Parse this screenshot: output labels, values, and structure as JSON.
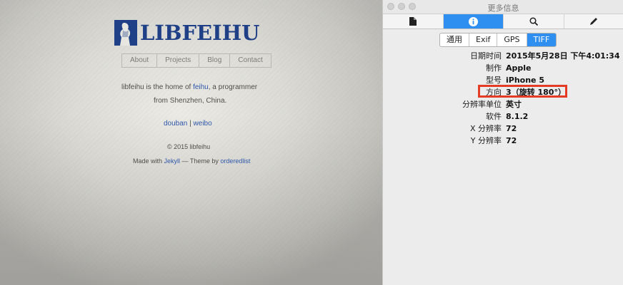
{
  "site": {
    "logo_text": "LIBFEIHU",
    "nav": [
      "About",
      "Projects",
      "Blog",
      "Contact"
    ],
    "intro_before": "libfeihu is the home of ",
    "intro_link": "feihu",
    "intro_after": ", a programmer",
    "intro_line2": "from Shenzhen, China.",
    "social": [
      "douban",
      "weibo"
    ],
    "social_sep": "|",
    "copyright": "© 2015 libfeihu",
    "made_with": "Made with ",
    "jekyll": "Jekyll",
    "theme_by": " — Theme by ",
    "theme_author": "orderedlist"
  },
  "panel": {
    "window_title": "更多信息",
    "toolbar_icons": [
      "file-icon",
      "info-icon",
      "search-icon",
      "pencil-icon"
    ],
    "active_toolbar_index": 1,
    "segments": [
      "通用",
      "Exif",
      "GPS",
      "TIFF"
    ],
    "active_segment": "TIFF",
    "rows": [
      {
        "label": "日期时间",
        "value": "2015年5月28日 下午4:01:34"
      },
      {
        "label": "制作",
        "value": "Apple"
      },
      {
        "label": "型号",
        "value": "iPhone 5"
      },
      {
        "label": "方向",
        "value": "3（旋转 180°）"
      },
      {
        "label": "分辨率单位",
        "value": "英寸"
      },
      {
        "label": "软件",
        "value": "8.1.2"
      },
      {
        "label": "X 分辨率",
        "value": "72"
      },
      {
        "label": "Y 分辨率",
        "value": "72"
      }
    ],
    "highlight_color": "#e53b24",
    "accent_color": "#2f8ff0"
  }
}
